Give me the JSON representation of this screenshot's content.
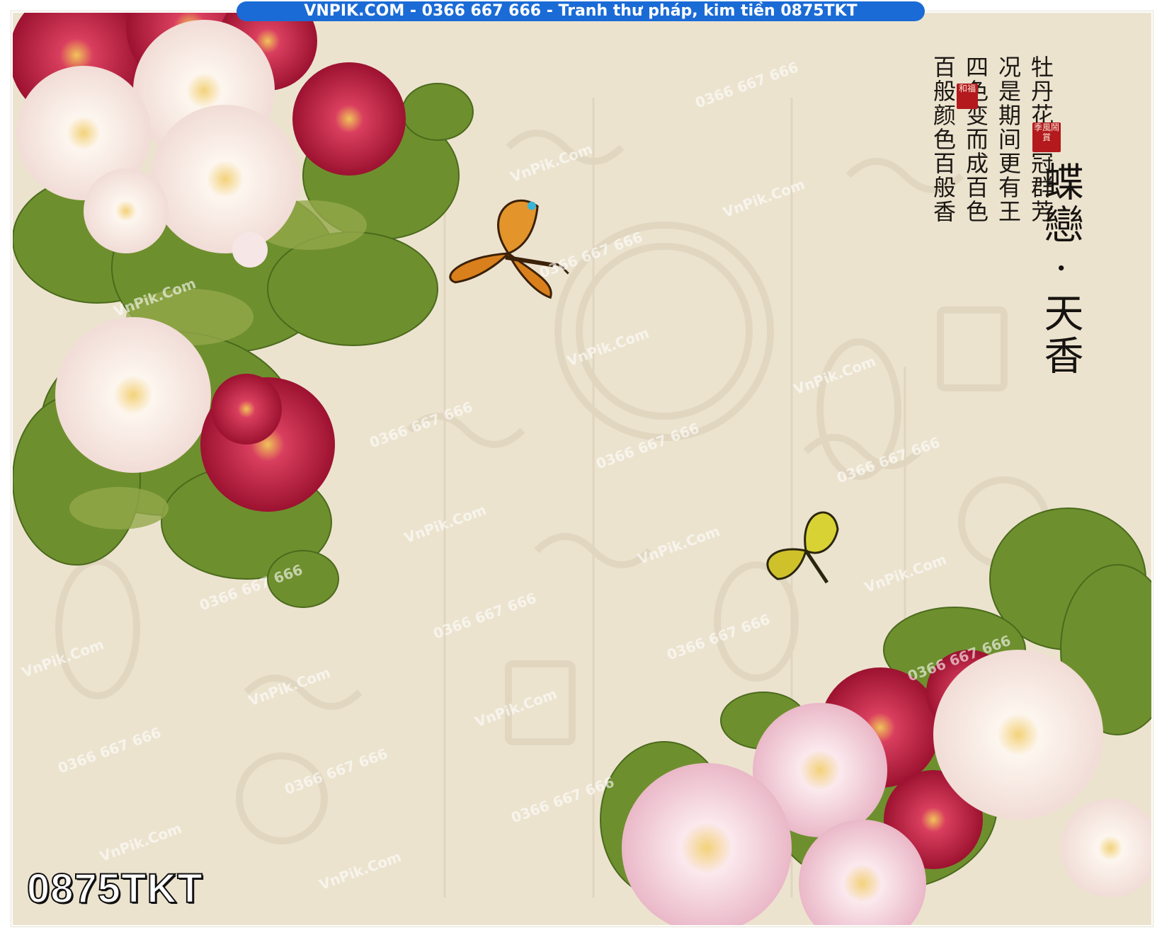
{
  "banner": {
    "text": "VNPIK.COM - 0366 667 666 - Tranh thư pháp, kim tiền 0875TKT"
  },
  "product_code": "0875TKT",
  "title": "蝶戀 · 天香",
  "poem_columns": [
    "牡丹花品冠群芳",
    "况是期间更有王",
    "四色变而成百色",
    "百般颜色百般香"
  ],
  "seals": [
    "和福",
    "季風鬧賞"
  ],
  "watermarks": [
    "VnPik.Com",
    "0366 667 666"
  ],
  "colors": {
    "background": "#ece3cf",
    "banner": "#1a6bd6",
    "peony_red": "#b5163a",
    "peony_white": "#fbf4ef",
    "leaf_green": "#6e8f2e",
    "seal_red": "#b3191d",
    "butterfly_orange": "#d9801c",
    "butterfly_yellow": "#d8d234"
  },
  "icons": [
    "peony-flower-icon",
    "butterfly-icon",
    "seal-stamp-icon"
  ]
}
